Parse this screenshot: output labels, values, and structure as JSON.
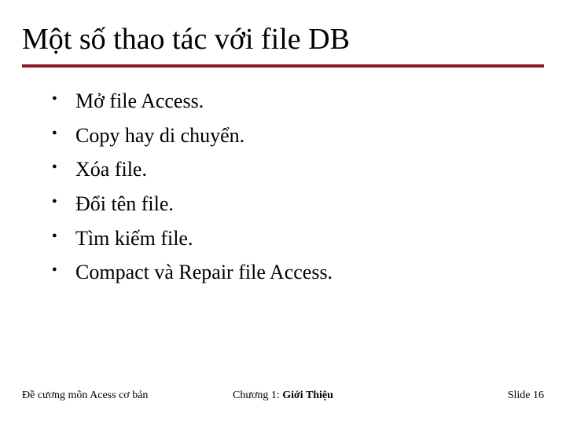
{
  "title": "Một số thao tác với file DB",
  "bullets": [
    "Mở file Access.",
    "Copy hay di chuyển.",
    "Xóa file.",
    "Đổi tên file.",
    "Tìm kiếm file.",
    "Compact và Repair file Access."
  ],
  "footer": {
    "left": "Đề cương môn Acess cơ bản",
    "center_prefix": "Chương 1: ",
    "center_bold": "Giới Thiệu",
    "right": "Slide 16"
  }
}
